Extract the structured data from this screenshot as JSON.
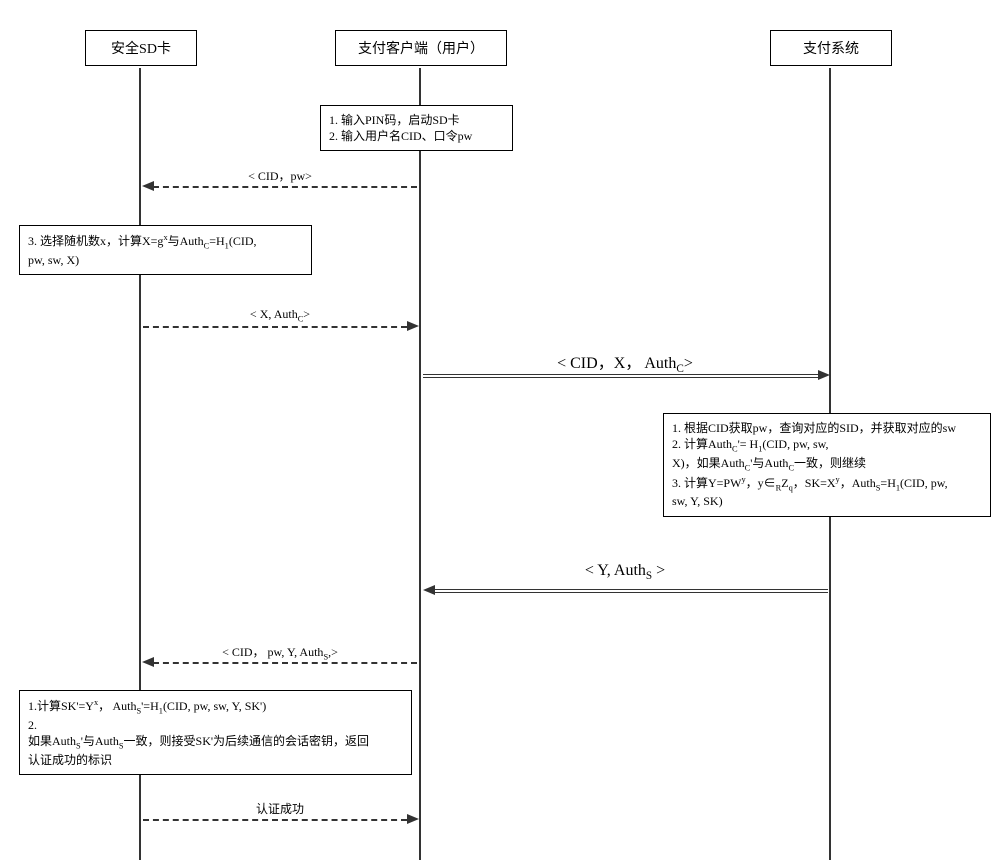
{
  "lanes": {
    "sd": {
      "title": "安全SD卡"
    },
    "client": {
      "title": "支付客户端（用户）"
    },
    "system": {
      "title": "支付系统"
    }
  },
  "note_client_start": {
    "l1": "1. 输入PIN码，启动SD卡",
    "l2": "2. 输入用户名CID、口令pw"
  },
  "msg_client_to_sd_1": "< CID，pw>",
  "note_sd_step3": {
    "ln1a": "3. 选择随机数x，计算X=g",
    "ln1b": "与Auth",
    "ln1c": "=H",
    "ln1d": "(CID,",
    "ln2": "pw, sw, X)"
  },
  "msg_sd_to_client_1a": "< X, Auth",
  "msg_sd_to_client_1b": ">",
  "msg_client_to_system_1a": "< CID，X， Auth",
  "msg_client_to_system_1b": ">",
  "note_system": {
    "s1": "1. 根据CID获取pw，查询对应的SID，并获取对应的sw",
    "s2a": "2. 计算Auth",
    "s2b": "'= H",
    "s2c": "(CID, pw, sw,",
    "s3a": "X)，如果Auth",
    "s3b": "'与Auth",
    "s3c": "一致，则继续",
    "s4a": "3. 计算Y=PW",
    "s4b": "，y∈",
    "s4c": "Z",
    "s4d": "，SK=X",
    "s4e": "，Auth",
    "s4f": "=H",
    "s4g": "(CID, pw,",
    "s5": "sw, Y, SK)"
  },
  "msg_system_to_client_a": "< Y, Auth",
  "msg_system_to_client_b": " >",
  "msg_client_to_sd_2a": "< CID， pw, Y, Auth",
  "msg_client_to_sd_2b": ",>",
  "note_sd_final": {
    "l1a": "1.计算SK'=Y",
    "l1b": "， Auth",
    "l1c": "'=H",
    "l1d": "(CID, pw, sw, Y, SK')",
    "l2": "2.",
    "l3a": "如果Auth",
    "l3b": "'与Auth",
    "l3c": "一致，则接受SK'为后续通信的会话密钥，返回",
    "l4": "认证成功的标识"
  },
  "msg_sd_to_client_final": "认证成功"
}
